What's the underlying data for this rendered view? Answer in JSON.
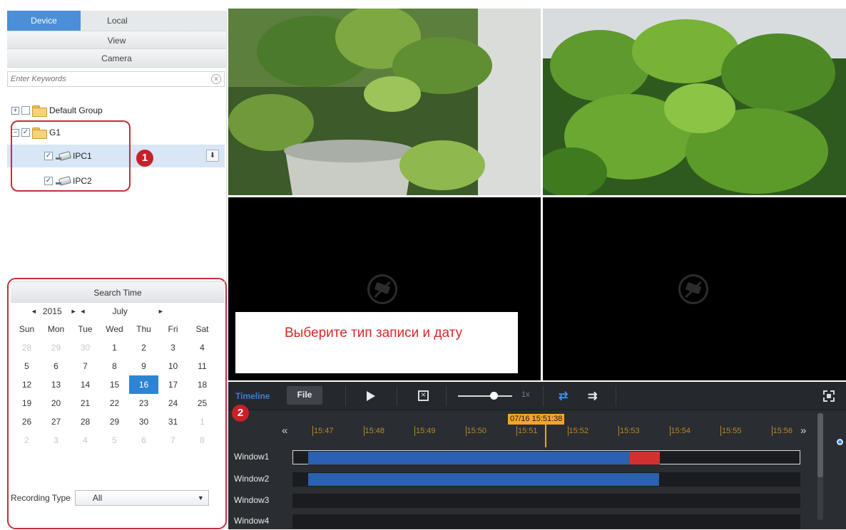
{
  "tabs": {
    "device": "Device",
    "local": "Local"
  },
  "view_label": "View",
  "camera_label": "Camera",
  "search": {
    "placeholder": "Enter Keywords"
  },
  "tree": {
    "default_group": "Default Group",
    "g1": "G1",
    "ipc1": "IPC1",
    "ipc2": "IPC2"
  },
  "callouts": {
    "one": "1",
    "two": "2"
  },
  "calendar": {
    "header": "Search Time",
    "year": "2015",
    "month": "July",
    "prev": "◄",
    "next": "►",
    "weekdays": [
      "Sun",
      "Mon",
      "Tue",
      "Wed",
      "Thu",
      "Fri",
      "Sat"
    ],
    "days": [
      [
        "28",
        "29",
        "30",
        "1",
        "2",
        "3",
        "4"
      ],
      [
        "5",
        "6",
        "7",
        "8",
        "9",
        "10",
        "11"
      ],
      [
        "12",
        "13",
        "14",
        "15",
        "16",
        "17",
        "18"
      ],
      [
        "19",
        "20",
        "21",
        "22",
        "23",
        "24",
        "25"
      ],
      [
        "26",
        "27",
        "28",
        "29",
        "30",
        "31",
        "1"
      ],
      [
        "2",
        "3",
        "4",
        "5",
        "6",
        "7",
        "8"
      ]
    ],
    "selected_day": "16"
  },
  "recording": {
    "label": "Recording Type",
    "value": "All"
  },
  "annotation": "Выберите тип записи и дату",
  "playback": {
    "timeline_tab": "Timeline",
    "file_tab": "File",
    "speed": "1x",
    "cursor": "07/16  15:51:38",
    "ticks": [
      "15:47",
      "15:48",
      "15:49",
      "15:50",
      "15:51",
      "15:52",
      "15:53",
      "15:54",
      "15:55",
      "15:56"
    ],
    "windows": [
      "Window1",
      "Window2",
      "Window3",
      "Window4"
    ],
    "prev_arrow": "«",
    "next_arrow": "»"
  },
  "colors": {
    "accent": "#2d84d6",
    "callout": "#c2303a",
    "recording_normal": "#2c60b0",
    "recording_alarm": "#d43030",
    "cursor": "#f4a42c"
  }
}
